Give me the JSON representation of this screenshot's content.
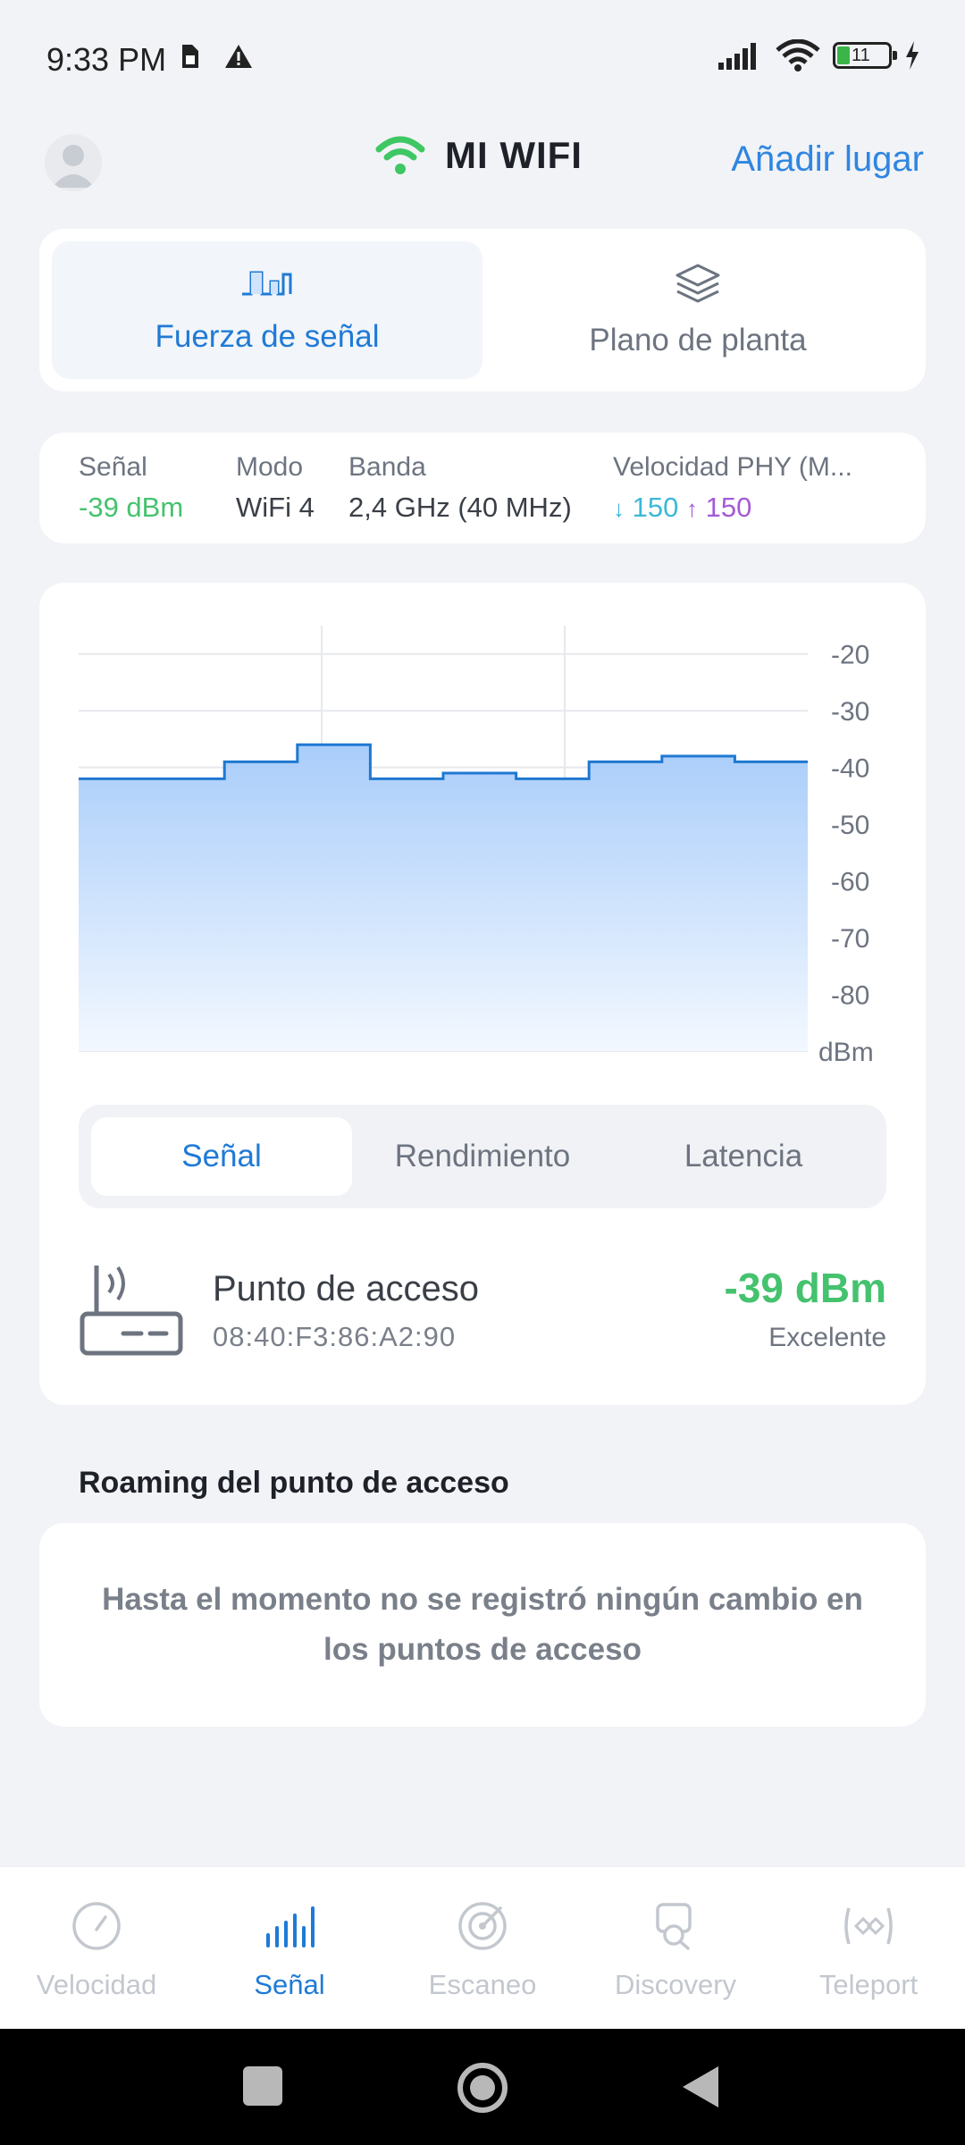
{
  "status_bar": {
    "time": "9:33 PM",
    "battery": "11",
    "icons": [
      "sim-card-icon",
      "warning-icon",
      "signal-bars-icon",
      "wifi-icon",
      "battery-icon",
      "charging-bolt-icon"
    ]
  },
  "header": {
    "title": "MI WIFI",
    "add_place_label": "Añadir lugar"
  },
  "top_tabs": [
    {
      "label": "Fuerza de señal",
      "icon": "signal-waveform-icon",
      "active": true
    },
    {
      "label": "Plano de planta",
      "icon": "layers-icon",
      "active": false
    }
  ],
  "info": {
    "signal_label": "Señal",
    "signal_value": "-39 dBm",
    "mode_label": "Modo",
    "mode_value": "WiFi 4",
    "band_label": "Banda",
    "band_value": "2,4 GHz (40 MHz)",
    "phy_label": "Velocidad PHY (M...",
    "phy_down": "150",
    "phy_up": "150",
    "down_arrow": "↓",
    "up_arrow": "↑"
  },
  "chart_data": {
    "type": "area",
    "unit_label": "dBm",
    "y_ticks": [
      "-20",
      "-30",
      "-40",
      "-50",
      "-60",
      "-70",
      "-80"
    ],
    "ylim": [
      -90,
      -15
    ],
    "x": [
      0,
      1,
      2,
      3,
      4,
      5,
      6,
      7,
      8,
      9
    ],
    "values": [
      -42,
      -42,
      -39,
      -36,
      -42,
      -41,
      -42,
      -39,
      -38,
      -39
    ],
    "colors": {
      "line": "#1f78d1",
      "fill_top": "#a9cdfa",
      "fill_bottom": "#f3f8ff"
    }
  },
  "metric_tabs": [
    {
      "label": "Señal",
      "active": true
    },
    {
      "label": "Rendimiento",
      "active": false
    },
    {
      "label": "Latencia",
      "active": false
    }
  ],
  "access_point": {
    "name": "Punto de acceso",
    "mac": "08:40:F3:86:A2:90",
    "dbm": "-39 dBm",
    "quality": "Excelente"
  },
  "roaming": {
    "title": "Roaming del punto de acceso",
    "message": "Hasta el momento no se registró ningún cambio en los puntos de acceso"
  },
  "bottom_nav": [
    {
      "label": "Velocidad",
      "icon": "speedometer-icon",
      "active": false
    },
    {
      "label": "Señal",
      "icon": "signal-bars-icon",
      "active": true
    },
    {
      "label": "Escaneo",
      "icon": "radar-icon",
      "active": false
    },
    {
      "label": "Discovery",
      "icon": "discovery-icon",
      "active": false
    },
    {
      "label": "Teleport",
      "icon": "teleport-icon",
      "active": false
    }
  ],
  "colors": {
    "accent": "#1f7ad6",
    "good": "#45c26e",
    "down_speed": "#3bb8d8",
    "up_speed": "#a35ad6"
  }
}
